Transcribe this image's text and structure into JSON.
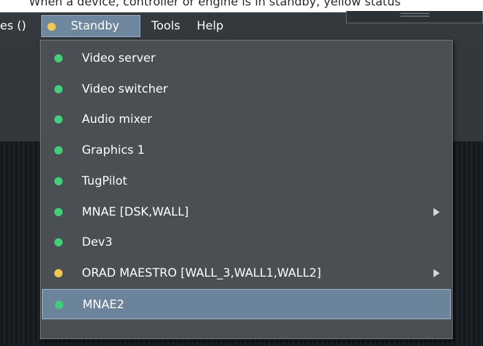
{
  "caption": "When a device, controller or engine is in standby, yellow status",
  "menubar": {
    "previous_label": "es ()",
    "standby_label": "Standby",
    "tools_label": "Tools",
    "help_label": "Help",
    "standby_status_color": "#f2c94c"
  },
  "colors": {
    "ok": "#3fd17a",
    "standby": "#f2c94c",
    "selected_bg": "#6c849b"
  },
  "dropdown": {
    "items": [
      {
        "label": "Video server",
        "status": "ok",
        "submenu": false
      },
      {
        "label": "Video switcher",
        "status": "ok",
        "submenu": false
      },
      {
        "label": "Audio mixer",
        "status": "ok",
        "submenu": false
      },
      {
        "label": "Graphics 1",
        "status": "ok",
        "submenu": false
      },
      {
        "label": "TugPilot",
        "status": "ok",
        "submenu": false
      },
      {
        "label": "MNAE [DSK,WALL]",
        "status": "ok",
        "submenu": true
      },
      {
        "label": "Dev3",
        "status": "ok",
        "submenu": false
      },
      {
        "label": "ORAD MAESTRO [WALL_3,WALL1,WALL2]",
        "status": "standby",
        "submenu": true
      },
      {
        "label": "MNAE2",
        "status": "ok",
        "submenu": false,
        "selected": true
      }
    ]
  }
}
